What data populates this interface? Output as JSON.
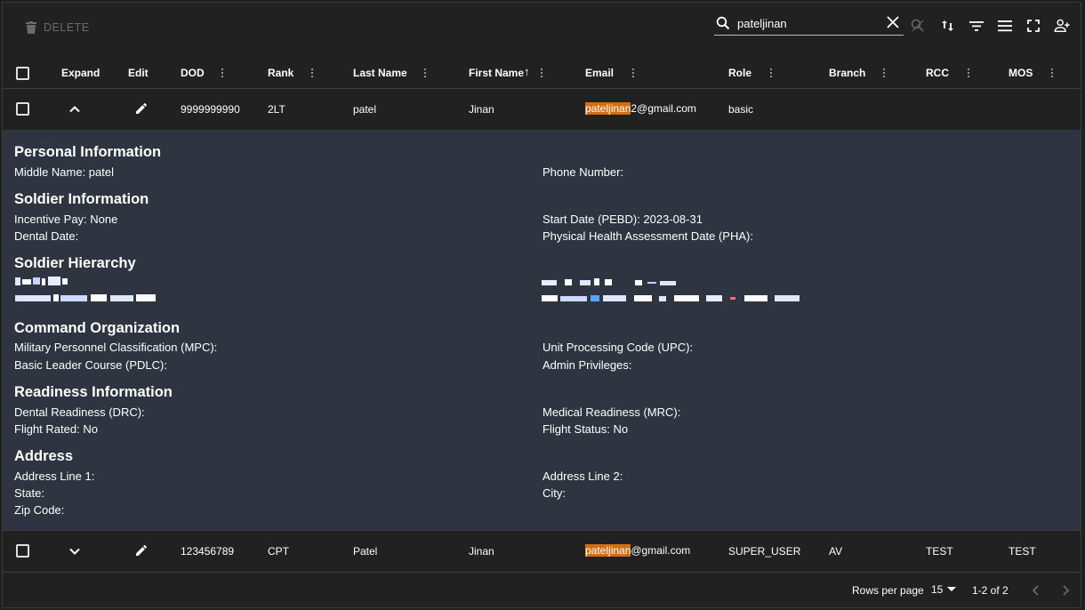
{
  "toolbar": {
    "delete_label": "DELETE",
    "search_value": "pateljinan"
  },
  "columns": {
    "expand": "Expand",
    "edit": "Edit",
    "dod": "DOD",
    "rank": "Rank",
    "last_name": "Last Name",
    "first_name": "First Name",
    "first_name_sort_icon": "↑",
    "email": "Email",
    "role": "Role",
    "branch": "Branch",
    "rcc": "RCC",
    "mos": "MOS"
  },
  "rows": [
    {
      "dod": "9999999990",
      "rank": "2LT",
      "last_name": "patel",
      "first_name": "Jinan",
      "email_highlight": "pateljinan",
      "email_rest": "2@gmail.com",
      "role": "basic",
      "branch": "",
      "rcc": "",
      "mos": "",
      "expanded": true
    },
    {
      "dod": "123456789",
      "rank": "CPT",
      "last_name": "Patel",
      "first_name": "Jinan",
      "email_highlight": "pateljinan",
      "email_rest": "@gmail.com",
      "role": "SUPER_USER",
      "branch": "AV",
      "rcc": "TEST",
      "mos": "TEST",
      "expanded": false
    }
  ],
  "detail": {
    "personal_title": "Personal Information",
    "middle_name": "Middle Name: patel",
    "phone_number": "Phone Number:",
    "soldier_title": "Soldier Information",
    "incentive_pay": "Incentive Pay: None",
    "start_date": "Start Date (PEBD): 2023-08-31",
    "dental_date": "Dental Date:",
    "pha_date": "Physical Health Assessment Date (PHA):",
    "hierarchy_title": "Soldier Hierarchy",
    "command_title": "Command Organization",
    "mpc": "Military Personnel Classification (MPC):",
    "upc": "Unit Processing Code (UPC):",
    "pdlc": "Basic Leader Course (PDLC):",
    "admin_privileges": "Admin Privileges:",
    "readiness_title": "Readiness Information",
    "drc": "Dental Readiness (DRC):",
    "mrc": "Medical Readiness (MRC):",
    "flight_rated": "Flight Rated: No",
    "flight_status": "Flight Status: No",
    "address_title": "Address",
    "address_line1": "Address Line 1:",
    "address_line2": "Address Line 2:",
    "state": "State:",
    "city": "City:",
    "zip": "Zip Code:"
  },
  "footer": {
    "rows_per_page_label": "Rows per page",
    "rows_per_page_value": "15",
    "range": "1-2 of 2"
  },
  "colors": {
    "highlight": "#d06f12",
    "detail_bg": "#2e3440",
    "table_bg": "#212121"
  }
}
